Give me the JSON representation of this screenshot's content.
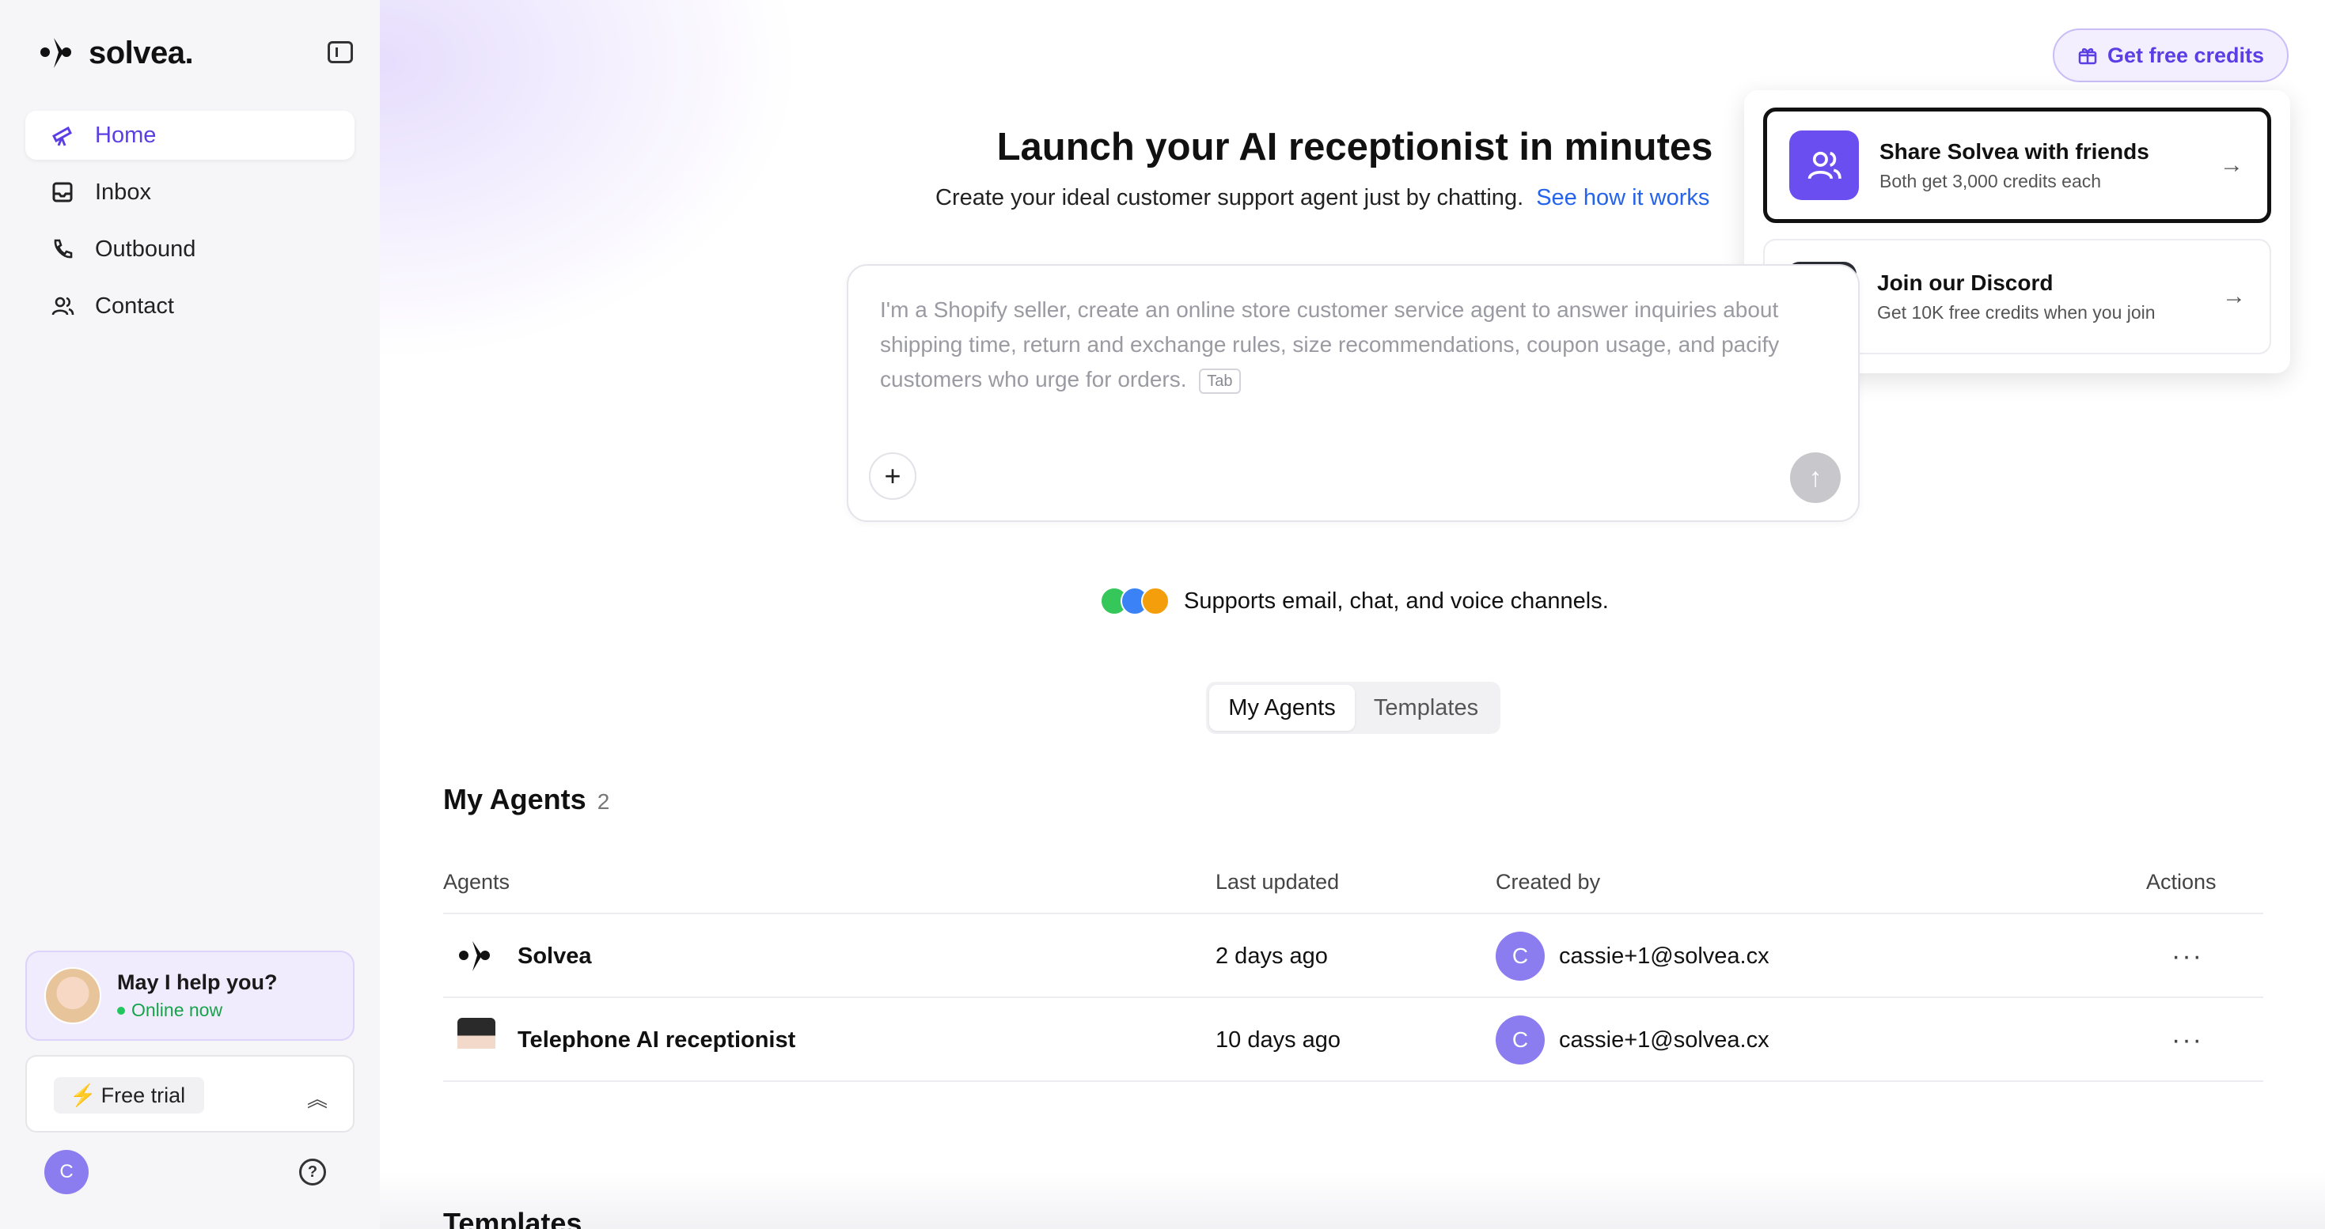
{
  "brand": {
    "name": "solvea."
  },
  "sidebar": {
    "items": [
      {
        "label": "Home",
        "icon": "telescope-icon",
        "active": true
      },
      {
        "label": "Inbox",
        "icon": "inbox-icon"
      },
      {
        "label": "Outbound",
        "icon": "phone-icon"
      },
      {
        "label": "Contact",
        "icon": "users-icon"
      }
    ],
    "help": {
      "title": "May I help you?",
      "status": "Online now"
    },
    "trial": {
      "label": "Free trial"
    },
    "user_initial": "C"
  },
  "header": {
    "credits_label": "Get free credits"
  },
  "popover": {
    "items": [
      {
        "title": "Share Solvea with friends",
        "subtitle": "Both get 3,000 credits each"
      },
      {
        "title": "Join our Discord",
        "subtitle": "Get 10K free credits when you join"
      }
    ]
  },
  "hero": {
    "title": "Launch your AI receptionist in minutes",
    "subtitle": "Create your ideal customer support agent just by chatting.",
    "link": "See how it works",
    "placeholder": "I'm a Shopify seller, create an online store customer service agent to answer inquiries about shipping time, return and exchange rules, size recommendations, coupon usage, and pacify customers who urge for orders.",
    "tab_key": "Tab"
  },
  "channels": {
    "text": "Supports email, chat, and voice channels.",
    "colors": [
      "#35c759",
      "#3b82f6",
      "#f59e0b"
    ]
  },
  "segment": {
    "tabs": [
      "My Agents",
      "Templates"
    ],
    "active": "My Agents"
  },
  "agents": {
    "title": "My Agents",
    "count": "2",
    "columns": [
      "Agents",
      "Last updated",
      "Created by",
      "Actions"
    ],
    "rows": [
      {
        "name": "Solvea",
        "updated": "2 days ago",
        "creator_initial": "C",
        "creator": "cassie+1@solvea.cx",
        "actions": "···"
      },
      {
        "name": "Telephone AI receptionist",
        "updated": "10 days ago",
        "creator_initial": "C",
        "creator": "cassie+1@solvea.cx",
        "actions": "···"
      }
    ]
  },
  "templates": {
    "title": "Templates"
  },
  "colors": {
    "accent": "#5b3ee4",
    "link": "#2563eb"
  }
}
